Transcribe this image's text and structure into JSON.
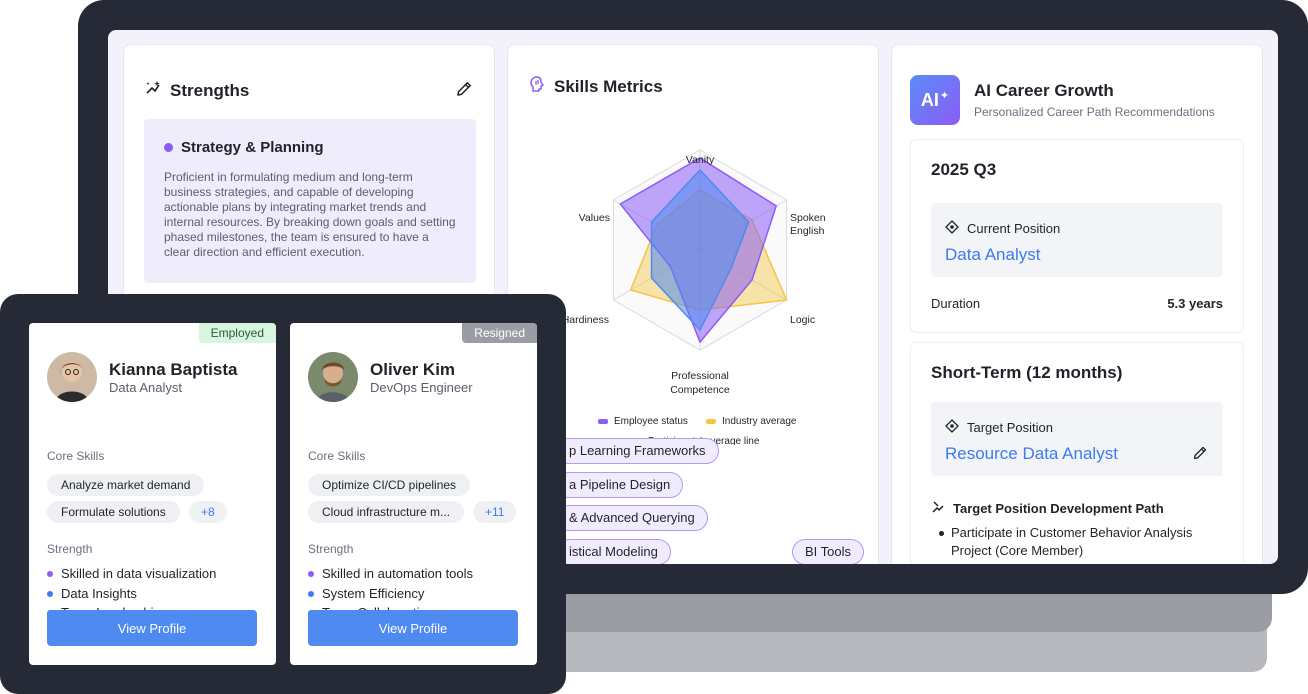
{
  "strengths": {
    "title": "Strengths",
    "item_title": "Strategy & Planning",
    "item_desc": "Proficient in formulating medium and long-term business strategies, and capable of developing actionable plans by integrating market trends and internal resources. By breaking down goals and setting phased milestones, the team is ensured to have a clear direction and efficient execution."
  },
  "metrics": {
    "title": "Skills Metrics",
    "tags": [
      "p Learning Frameworks",
      "a Pipeline Design",
      "& Advanced Querying",
      "istical Modeling",
      "BI Tools"
    ]
  },
  "chart_data": {
    "type": "radar",
    "axes": [
      "Vanity",
      "Spoken\nEnglish",
      "Logic",
      "Professional\nCompetence",
      "Hardiness",
      "Values"
    ],
    "axis_labels": {
      "vanity": "Vanity",
      "spoken_1": "Spoken",
      "spoken_2": "English",
      "logic": "Logic",
      "prof_1": "Professional",
      "prof_2": "Competence",
      "hardiness": "Hardiness",
      "values": "Values"
    },
    "rlim": [
      0,
      5
    ],
    "series": [
      {
        "name": "Employee status",
        "color": "#8b5cf6",
        "values": [
          4.6,
          4.4,
          3.0,
          4.6,
          1.7,
          4.6
        ]
      },
      {
        "name": "Industry average",
        "color": "#f5c542",
        "values": [
          3.0,
          3.0,
          5.0,
          3.0,
          4.0,
          2.5
        ]
      },
      {
        "name": "Participants' average line",
        "color": "#4f8af0",
        "values": [
          4.0,
          2.8,
          1.8,
          4.0,
          2.8,
          2.8
        ]
      }
    ],
    "legend_position": "bottom"
  },
  "career": {
    "logo": "AI",
    "title": "AI Career Growth",
    "subtitle": "Personalized Career Path Recommendations",
    "q3": {
      "heading": "2025 Q3",
      "position_label": "Current Position",
      "position_value": "Data Analyst",
      "duration_label": "Duration",
      "duration_value": "5.3 years"
    },
    "short_term": {
      "heading": "Short-Term (12 months)",
      "position_label": "Target Position",
      "position_value": "Resource Data Analyst",
      "path_title": "Target Position Development Path",
      "path_item": "Participate in Customer Behavior Analysis Project (Core Member)"
    }
  },
  "employees": [
    {
      "status": "Employed",
      "name": "Kianna Baptista",
      "role": "Data Analyst",
      "core_label": "Core Skills",
      "skills": [
        "Analyze market demand",
        "Formulate solutions"
      ],
      "more": "+8",
      "strength_label": "Strength",
      "strengths": [
        "Skilled in data visualization",
        "Data Insights",
        "Team Leadership"
      ],
      "button": "View Profile"
    },
    {
      "status": "Resigned",
      "name": "Oliver Kim",
      "role": "DevOps Engineer",
      "core_label": "Core Skills",
      "skills": [
        "Optimize CI/CD pipelines",
        "Cloud infrastructure m..."
      ],
      "more": "+11",
      "strength_label": "Strength",
      "strengths": [
        "Skilled in automation tools",
        "System Efficiency",
        "Team Collaboration"
      ],
      "button": "View Profile"
    }
  ],
  "colors": {
    "accent_blue": "#3b7bf0",
    "accent_purple": "#8b5cf6",
    "bullet_green": "#2fc46d"
  }
}
